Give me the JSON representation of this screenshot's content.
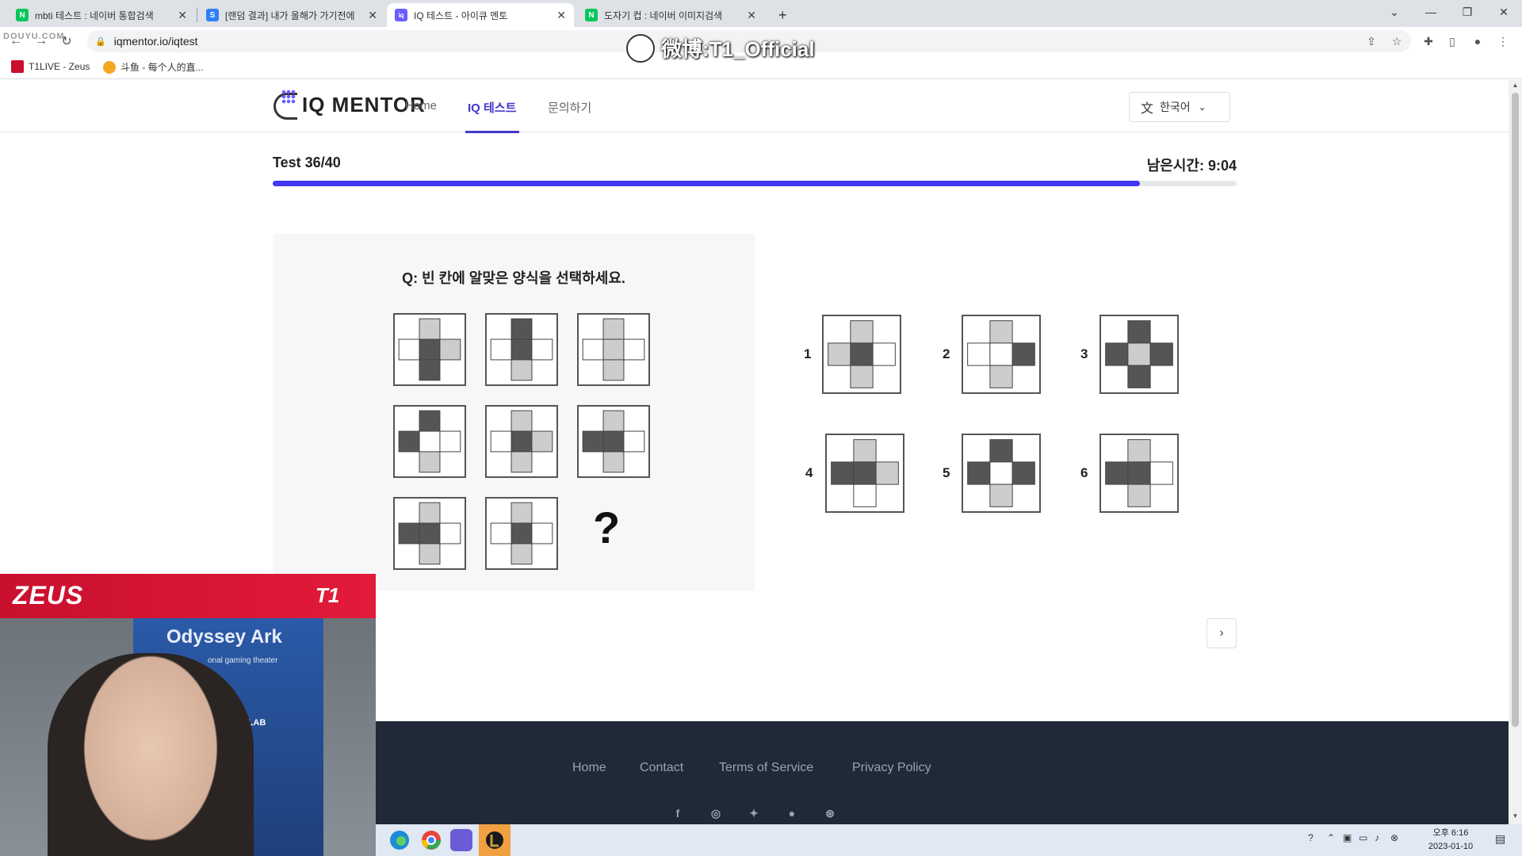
{
  "browser": {
    "tabs": [
      {
        "title": "mbti 테스트 : 네이버 통합검색",
        "favicon_color": "#03c75a",
        "favicon_letter": "N"
      },
      {
        "title": "[랜덤 결과] 내가 올해가 가기전에",
        "favicon_color": "#2d7ff9",
        "favicon_letter": "S"
      },
      {
        "title": "IQ 테스트 - 아이큐 멘토",
        "favicon_color": "#6a5cff",
        "favicon_letter": "iq"
      },
      {
        "title": "도자기 컵 : 네이버 이미지검색",
        "favicon_color": "#03c75a",
        "favicon_letter": "N"
      }
    ],
    "new_tab": "+",
    "url": "iqmentor.io/iqtest",
    "bookmarks": [
      {
        "label": "T1LIVE - Zeus",
        "color": "#c8102e"
      },
      {
        "label": "斗鱼 - 每个人的直...",
        "color": "#f5a623"
      }
    ],
    "window_controls": {
      "tab_list": "⌄",
      "minimize": "—",
      "restore": "❐",
      "close": "✕"
    }
  },
  "watermark": {
    "text": "微博:T1_Official",
    "douyu": "DOUYU.COM"
  },
  "site": {
    "logo": "IQ MENTOR",
    "nav": {
      "home": "Home",
      "iq_test": "IQ 테스트",
      "contact": "문의하기"
    },
    "language": "한국어"
  },
  "test": {
    "counter": "Test 36/40",
    "timer_label": "남은시간:",
    "timer_value": "9:04",
    "progress": 0.9,
    "question": "Q: 빈 칸에 알맞은 양식을 선택하세요.",
    "missing_mark": "?",
    "colors": {
      "dark": "#555555",
      "hatch": "#d8d8d8",
      "white": "#ffffff"
    },
    "grid_cells": [
      {
        "top": "hatch",
        "left": "white",
        "center": "dark",
        "right": "hatch",
        "bottom": "dark"
      },
      {
        "top": "dark",
        "left": "white",
        "center": "dark",
        "right": "white",
        "bottom": "hatch"
      },
      {
        "top": "hatch",
        "left": "white",
        "center": "hatch",
        "right": "white",
        "bottom": "hatch"
      },
      {
        "top": "dark",
        "left": "dark",
        "center": "white",
        "right": "white",
        "bottom": "hatch"
      },
      {
        "top": "hatch",
        "left": "white",
        "center": "dark",
        "right": "hatch",
        "bottom": "hatch"
      },
      {
        "top": "hatch",
        "left": "dark",
        "center": "dark",
        "right": "white",
        "bottom": "hatch"
      },
      {
        "top": "hatch",
        "left": "dark",
        "center": "dark",
        "right": "white",
        "bottom": "hatch"
      },
      {
        "top": "hatch",
        "left": "white",
        "center": "dark",
        "right": "white",
        "bottom": "hatch"
      }
    ],
    "options": [
      {
        "number": "1",
        "pattern": {
          "top": "hatch",
          "left": "hatch",
          "center": "dark",
          "right": "white",
          "bottom": "hatch"
        }
      },
      {
        "number": "2",
        "pattern": {
          "top": "hatch",
          "left": "white",
          "center": "white",
          "right": "dark",
          "bottom": "hatch"
        }
      },
      {
        "number": "3",
        "pattern": {
          "top": "dark",
          "left": "dark",
          "center": "hatch",
          "right": "dark",
          "bottom": "dark"
        }
      },
      {
        "number": "4",
        "pattern": {
          "top": "hatch",
          "left": "dark",
          "center": "dark",
          "right": "hatch",
          "bottom": "white"
        }
      },
      {
        "number": "5",
        "pattern": {
          "top": "dark",
          "left": "dark",
          "center": "white",
          "right": "dark",
          "bottom": "hatch"
        }
      },
      {
        "number": "6",
        "pattern": {
          "top": "hatch",
          "left": "dark",
          "center": "dark",
          "right": "white",
          "bottom": "hatch"
        }
      }
    ],
    "next": "›"
  },
  "footer": {
    "links": {
      "home": "Home",
      "contact": "Contact",
      "terms": "Terms of Service",
      "privacy": "Privacy Policy"
    },
    "icons": [
      "facebook-icon",
      "instagram-icon",
      "twitter-icon",
      "github-icon",
      "dribbble-icon"
    ]
  },
  "taskbar": {
    "apps": [
      {
        "name": "edge-icon",
        "color": "#1f8ad6"
      },
      {
        "name": "chrome-icon",
        "color": "#e8453c"
      },
      {
        "name": "app-launcher-icon",
        "color": "#6b5bd6"
      },
      {
        "name": "league-icon",
        "color": "#c89b3c"
      }
    ],
    "clock_time": "오후 6:16",
    "clock_date": "2023-01-10"
  },
  "webcam": {
    "player_name": "ZEUS",
    "team_logo": "T1",
    "banner_text": "Odyssey Ark",
    "banner_sub": "onal gaming theater",
    "chair_brand": "SECRET LAB"
  }
}
